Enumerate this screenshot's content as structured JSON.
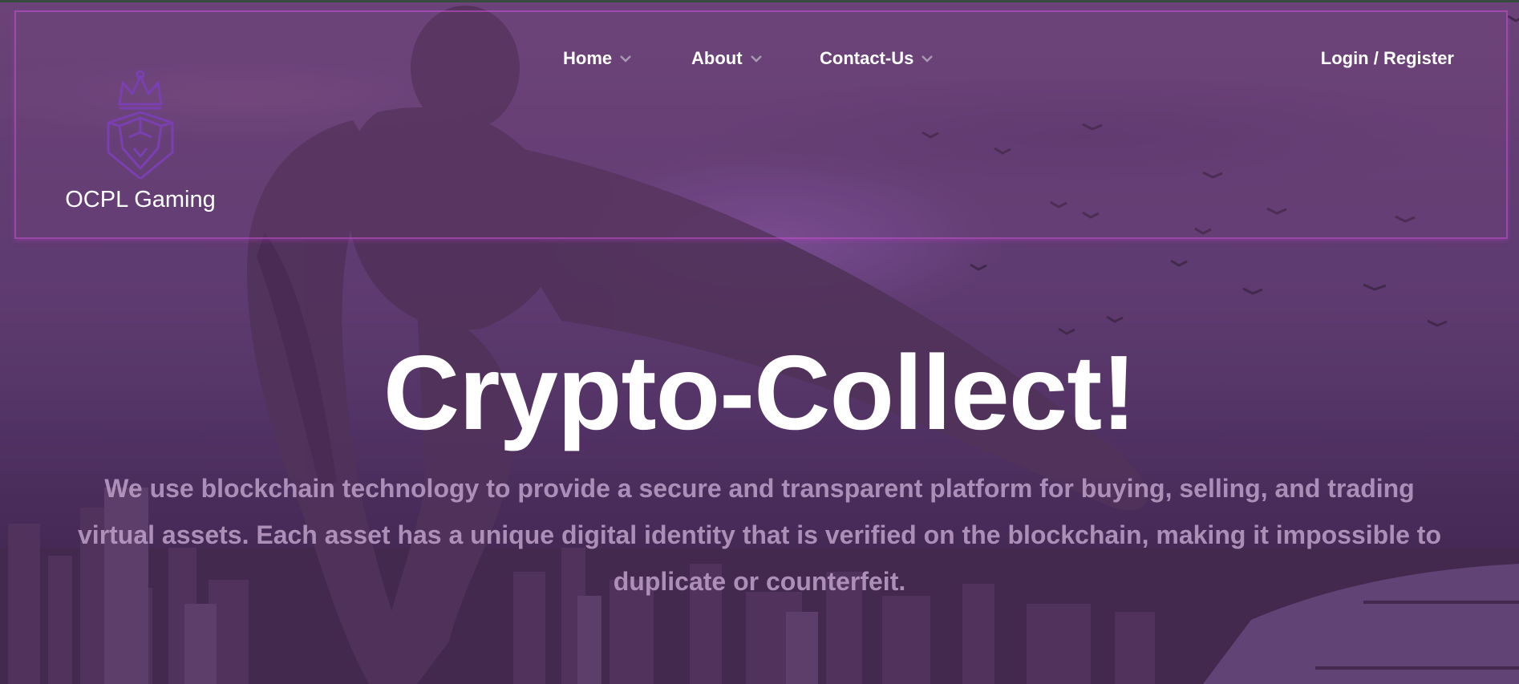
{
  "brand": {
    "name": "OCPL Gaming",
    "logo_icon": "crowned-lion-shield-icon"
  },
  "nav": {
    "items": [
      {
        "label": "Home",
        "icon": "chevron-down-icon"
      },
      {
        "label": "About",
        "icon": "chevron-down-icon"
      },
      {
        "label": "Contact-Us",
        "icon": "chevron-down-icon"
      }
    ],
    "login_label": "Login / Register"
  },
  "hero": {
    "title": "Crypto-Collect!",
    "description": "We use blockchain technology to provide a secure and transparent platform for buying, selling, and trading virtual assets. Each asset has a unique digital identity that is verified on the blockchain, making it impossible to duplicate or counterfeit."
  },
  "colors": {
    "accent": "#7a3fb0",
    "nav_border": "#c850d2",
    "text": "#ffffff"
  }
}
